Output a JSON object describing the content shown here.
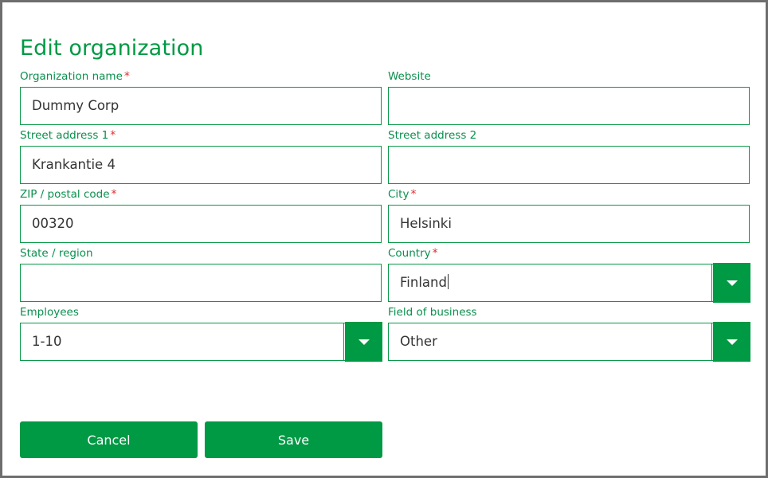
{
  "page": {
    "title": "Edit organization",
    "accent_color": "#009944",
    "label_color": "#0a8f4d",
    "required_marker_color": "#e03131",
    "required_marker": "*",
    "border_color": "#6e6e6e"
  },
  "fields": {
    "organization_name": {
      "label": "Organization name",
      "required": true,
      "value": "Dummy Corp",
      "placeholder": "",
      "type": "text"
    },
    "website": {
      "label": "Website",
      "required": false,
      "value": "",
      "placeholder": "",
      "type": "text"
    },
    "street_address_1": {
      "label": "Street address 1",
      "required": true,
      "value": "Krankantie 4",
      "placeholder": "",
      "type": "text"
    },
    "street_address_2": {
      "label": "Street address 2",
      "required": false,
      "value": "",
      "placeholder": "",
      "type": "text"
    },
    "zip_postal_code": {
      "label": "ZIP / postal code",
      "required": true,
      "value": "00320",
      "placeholder": "",
      "type": "text"
    },
    "city": {
      "label": "City",
      "required": true,
      "value": "Helsinki",
      "placeholder": "",
      "type": "text"
    },
    "state_region": {
      "label": "State / region",
      "required": false,
      "value": "",
      "placeholder": "",
      "type": "text"
    },
    "country": {
      "label": "Country",
      "required": true,
      "value": "Finland",
      "placeholder": "",
      "type": "select",
      "focused": true,
      "dropdown_icon": "chevron-down-icon"
    },
    "employees": {
      "label": "Employees",
      "required": false,
      "value": "1-10",
      "placeholder": "",
      "type": "select",
      "dropdown_icon": "chevron-down-icon"
    },
    "field_of_business": {
      "label": "Field of business",
      "required": false,
      "value": "Other",
      "placeholder": "",
      "type": "select",
      "dropdown_icon": "chevron-down-icon"
    }
  },
  "actions": {
    "cancel_label": "Cancel",
    "save_label": "Save"
  }
}
